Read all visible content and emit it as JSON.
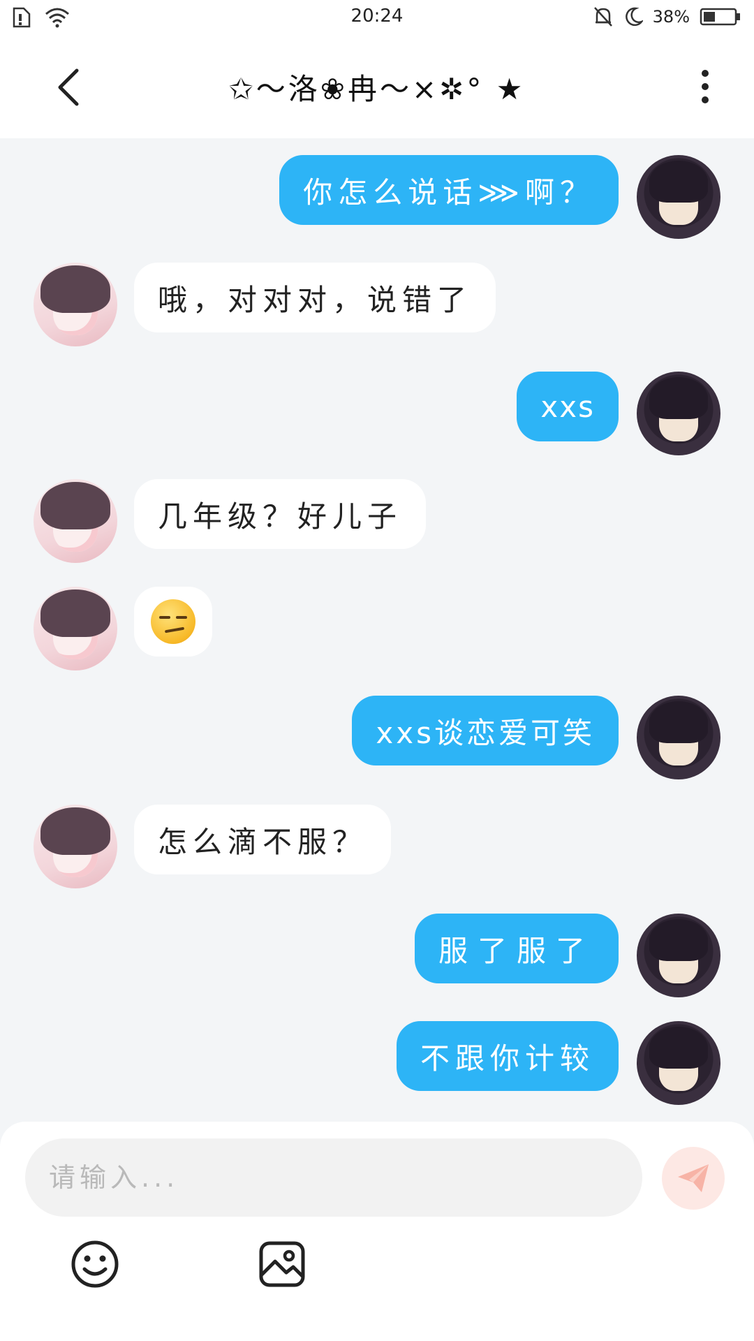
{
  "status_bar": {
    "time": "20:24",
    "battery": "38%"
  },
  "header": {
    "title": "✩～洛❀冉～×✲° ★"
  },
  "messages": [
    {
      "sender": "me",
      "text": "你怎么说话⋙啊？"
    },
    {
      "sender": "her",
      "text": "哦，对对对，说错了"
    },
    {
      "sender": "me",
      "text": "xxs"
    },
    {
      "sender": "her",
      "text": "几年级？好儿子"
    },
    {
      "sender": "her",
      "text": "",
      "emoji": "smirk-emoji"
    },
    {
      "sender": "me",
      "text": "xxs谈恋爱可笑"
    },
    {
      "sender": "her",
      "text": "怎么滴不服？"
    },
    {
      "sender": "me",
      "text": "服了服了"
    },
    {
      "sender": "me",
      "text": "不跟你计较"
    }
  ],
  "input": {
    "placeholder": "请输入..."
  },
  "colors": {
    "my_bubble": "#2db4f6",
    "her_bubble": "#ffffff",
    "background": "#f3f5f7",
    "send_button": "#fde8e4",
    "send_icon": "#f7b3a6"
  },
  "icons": {
    "back": "chevron-left-icon",
    "more": "more-vertical-icon",
    "send": "paper-plane-icon",
    "emoji": "smiley-icon",
    "image": "image-icon"
  }
}
